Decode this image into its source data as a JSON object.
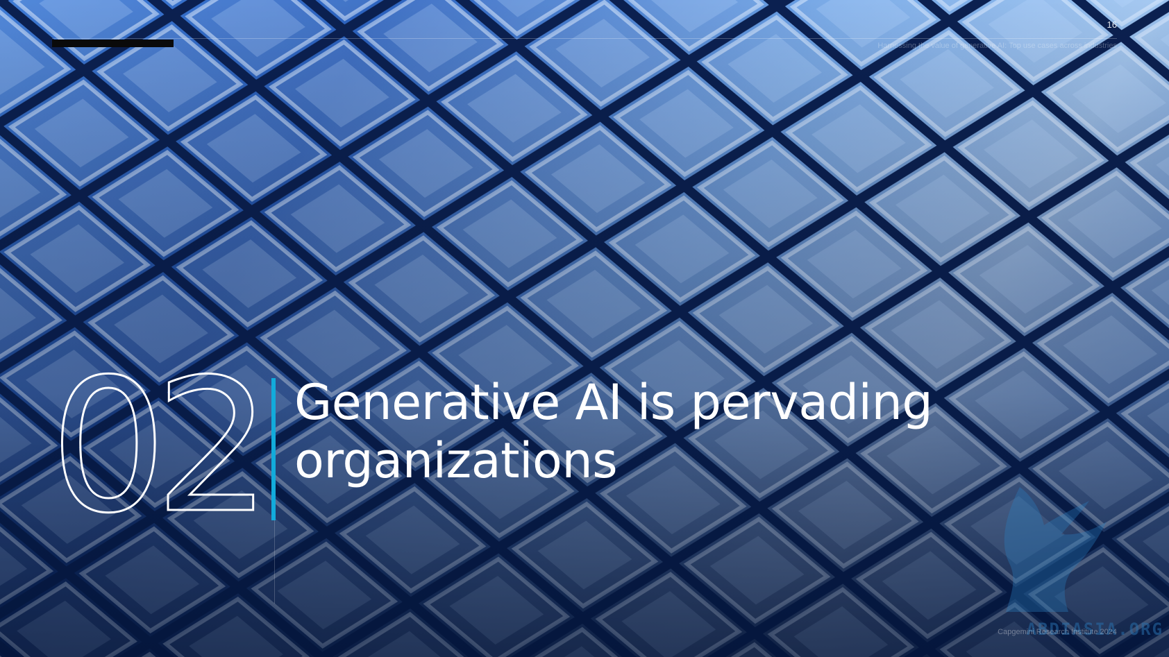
{
  "slide": {
    "page_number": "16",
    "running_head": "Harnessing the value of generative AI: Top use cases across industries",
    "chapter_number": "02",
    "title": "Generative AI is pervading organizations",
    "copyright": "Capgemini Research Institute 2024",
    "watermark": "ABDIASIA.ORG"
  },
  "colors": {
    "accent": "#12abdb",
    "title_text": "#ffffff",
    "top_bar": "#0a0a0a"
  }
}
